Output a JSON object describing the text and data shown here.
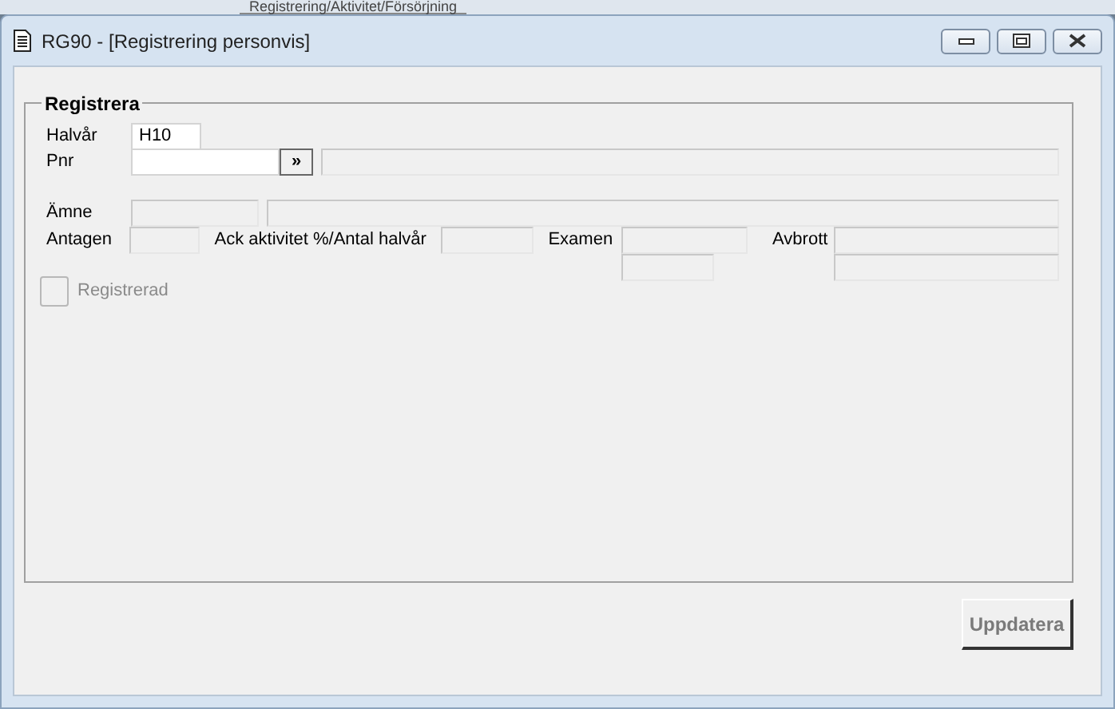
{
  "background_window": {
    "title": "Registrering/Aktivitet/Försörjning"
  },
  "window": {
    "title": "RG90 - [Registrering personvis]"
  },
  "group": {
    "title": "Registrera"
  },
  "halvar": {
    "label": "Halvår",
    "value": "H10",
    "disabled": false
  },
  "pnr": {
    "label": "Pnr",
    "disabled": false,
    "lookup_button": "»",
    "name_field": {
      "disabled": true
    }
  },
  "amne": {
    "label": "Ämne",
    "code_field": {
      "disabled": true
    },
    "name_field": {
      "disabled": true
    }
  },
  "antagen": {
    "label": "Antagen",
    "disabled": true
  },
  "ack_aktivitet": {
    "label": "Ack aktivitet %/Antal halvår",
    "disabled": true
  },
  "examen": {
    "label": "Examen",
    "fields": [
      {
        "disabled": true
      },
      {
        "disabled": true
      }
    ]
  },
  "avbrott": {
    "label": "Avbrott",
    "fields": [
      {
        "disabled": true
      },
      {
        "disabled": true
      }
    ]
  },
  "registrerad": {
    "label": "Registrerad",
    "checked": false,
    "disabled": true
  },
  "buttons": [
    {
      "label": "Uppdatera",
      "disabled": true
    }
  ]
}
